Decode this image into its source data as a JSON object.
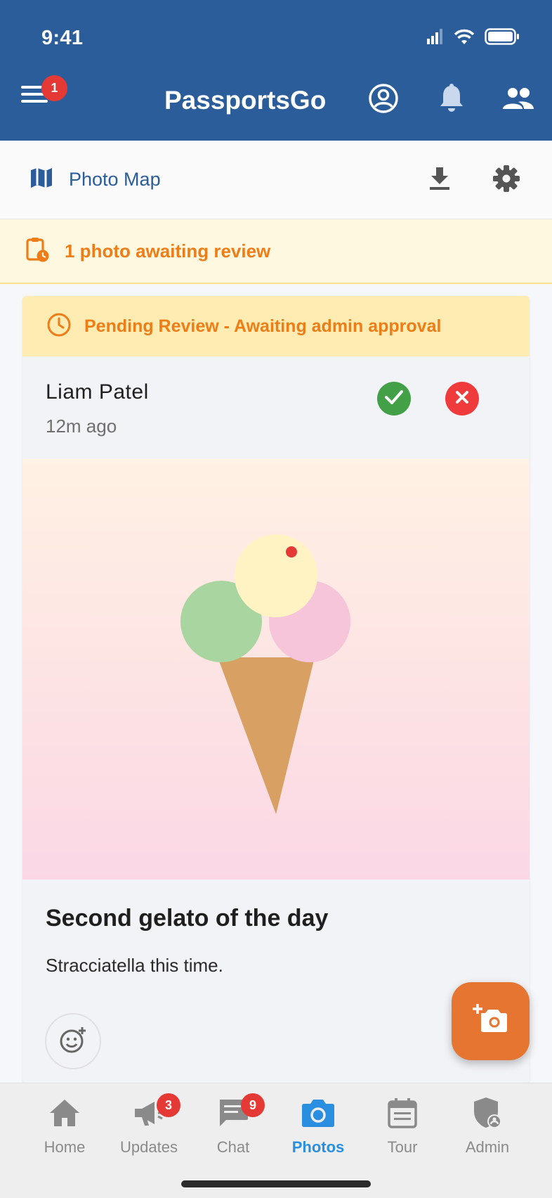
{
  "status_bar": {
    "time": "9:41"
  },
  "header": {
    "title": "PassportsGo",
    "menu_badge": "1",
    "icons": [
      "menu-icon",
      "account-circle-icon",
      "bell-icon",
      "people-icon"
    ]
  },
  "subbar": {
    "photo_map_label": "Photo Map",
    "icons": [
      "map-icon",
      "download-icon",
      "settings-icon"
    ]
  },
  "review_banner": {
    "text": "1 photo awaiting review"
  },
  "card": {
    "pending_text": "Pending Review - Awaiting admin approval",
    "author": "Liam Patel",
    "time_ago": "12m ago",
    "caption_title": "Second gelato of the day",
    "caption_text": "Stracciatella this time."
  },
  "colors": {
    "header": "#2a5d9a",
    "accent_orange": "#ef7d17",
    "fab": "#e57530",
    "active_nav": "#2a8fe0",
    "approve": "#43a047",
    "reject": "#ef3b3b"
  },
  "bottom_nav": {
    "items": [
      {
        "label": "Home",
        "icon": "home-icon"
      },
      {
        "label": "Updates",
        "icon": "megaphone-icon",
        "badge": "3"
      },
      {
        "label": "Chat",
        "icon": "chat-icon",
        "badge": "9"
      },
      {
        "label": "Photos",
        "icon": "camera-icon",
        "active": true
      },
      {
        "label": "Tour",
        "icon": "calendar-icon"
      },
      {
        "label": "Admin",
        "icon": "admin-shield-icon"
      }
    ]
  }
}
